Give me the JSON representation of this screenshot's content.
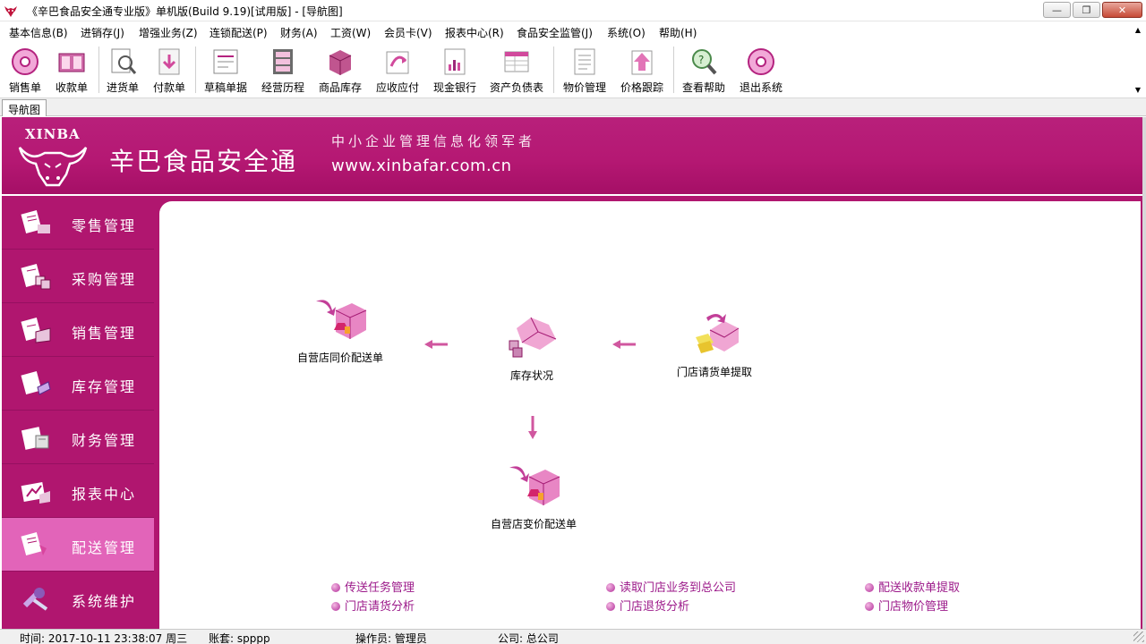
{
  "window": {
    "title": "《辛巴食品安全通专业版》单机版(Build 9.19)[试用版] - [导航图]",
    "controls": [
      "minimize",
      "maximize",
      "close"
    ]
  },
  "menu": [
    {
      "label": "基本信息(B)"
    },
    {
      "label": "进销存(J)"
    },
    {
      "label": "增强业务(Z)"
    },
    {
      "label": "连锁配送(P)"
    },
    {
      "label": "财务(A)"
    },
    {
      "label": "工资(W)"
    },
    {
      "label": "会员卡(V)"
    },
    {
      "label": "报表中心(R)"
    },
    {
      "label": "食品安全监管(J)"
    },
    {
      "label": "系统(O)"
    },
    {
      "label": "帮助(H)"
    }
  ],
  "toolbar": [
    {
      "label": "销售单",
      "icon": "sales-order-icon"
    },
    {
      "label": "收款单",
      "icon": "receipt-icon"
    },
    {
      "label": "进货单",
      "icon": "purchase-order-icon"
    },
    {
      "label": "付款单",
      "icon": "payment-icon"
    },
    {
      "label": "草稿单据",
      "icon": "draft-icon"
    },
    {
      "label": "经营历程",
      "icon": "history-icon"
    },
    {
      "label": "商品库存",
      "icon": "inventory-icon"
    },
    {
      "label": "应收应付",
      "icon": "receivable-icon"
    },
    {
      "label": "现金银行",
      "icon": "cash-bank-icon"
    },
    {
      "label": "资产负债表",
      "icon": "balance-sheet-icon"
    },
    {
      "label": "物价管理",
      "icon": "price-management-icon"
    },
    {
      "label": "价格跟踪",
      "icon": "price-tracking-icon"
    },
    {
      "label": "查看帮助",
      "icon": "help-icon"
    },
    {
      "label": "退出系统",
      "icon": "exit-icon"
    }
  ],
  "tabs": [
    {
      "label": "导航图"
    }
  ],
  "banner": {
    "logo_text": "XINBA",
    "brand": "辛巴食品安全通",
    "slogan": "中小企业管理信息化领军者",
    "url": "www.xinbafar.com.cn"
  },
  "sidebar": [
    {
      "label": "零售管理",
      "active": false
    },
    {
      "label": "采购管理",
      "active": false
    },
    {
      "label": "销售管理",
      "active": false
    },
    {
      "label": "库存管理",
      "active": false
    },
    {
      "label": "财务管理",
      "active": false
    },
    {
      "label": "报表中心",
      "active": false
    },
    {
      "label": "配送管理",
      "active": true
    },
    {
      "label": "系统维护",
      "active": false
    }
  ],
  "flow": {
    "nodes": [
      {
        "label": "自营店同价配送单"
      },
      {
        "label": "库存状况"
      },
      {
        "label": "门店请货单提取"
      },
      {
        "label": "自营店变价配送单"
      }
    ]
  },
  "links": [
    {
      "label": "传送任务管理"
    },
    {
      "label": "门店请货分析"
    },
    {
      "label": "读取门店业务到总公司"
    },
    {
      "label": "门店退货分析"
    },
    {
      "label": "配送收款单提取"
    },
    {
      "label": "门店物价管理"
    }
  ],
  "status": {
    "time": "时间: 2017-10-11 23:38:07 周三",
    "account": "账套: spppp",
    "operator": "操作员: 管理员",
    "company": "公司: 总公司"
  },
  "colors": {
    "accent": "#b0166f",
    "active_sidebar": "#e264b9",
    "link": "#9c1a8a"
  }
}
